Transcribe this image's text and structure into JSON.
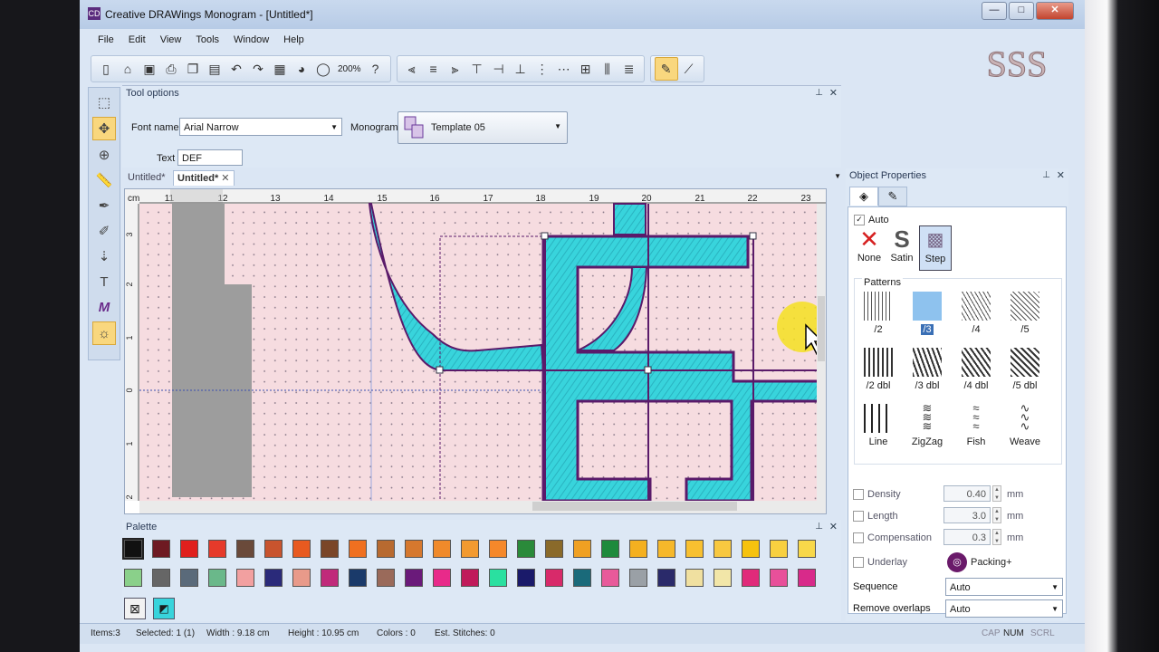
{
  "window": {
    "title": "Creative DRAWings Monogram - [Untitled*]",
    "min": "—",
    "max": "□",
    "close": "✕"
  },
  "menu": [
    "File",
    "Edit",
    "View",
    "Tools",
    "Window",
    "Help"
  ],
  "toolbar": {
    "zoom": "200%"
  },
  "logo": {
    "text": "SSS"
  },
  "tool_options": {
    "header": "Tool options",
    "font_label": "Font name",
    "font_value": "Arial Narrow",
    "monogram_label": "Monogram",
    "monogram_value": "Template 05",
    "text_label": "Text",
    "text_value": "DEF"
  },
  "doc_tabs": [
    "Untitled*",
    "Untitled*"
  ],
  "ruler": {
    "unit": "cm",
    "x_ticks": [
      "11",
      "12",
      "13",
      "14",
      "15",
      "16",
      "17",
      "18",
      "19",
      "20",
      "21",
      "22",
      "23"
    ],
    "y_ticks": [
      "3",
      "2",
      "1",
      "0",
      "1",
      "2"
    ]
  },
  "palette": {
    "header": "Palette"
  },
  "object_properties": {
    "header": "Object Properties",
    "auto_label": "Auto",
    "fill_types": [
      "None",
      "Satin",
      "Step"
    ],
    "patterns_header": "Patterns",
    "patterns": [
      "/2",
      "/3",
      "/4",
      "/5",
      "/2 dbl",
      "/3 dbl",
      "/4 dbl",
      "/5 dbl",
      "Line",
      "ZigZag",
      "Fish",
      "Weave"
    ],
    "selected_pattern": "/3",
    "density_label": "Density",
    "density_value": "0.40",
    "length_label": "Length",
    "length_value": "3.0",
    "compensation_label": "Compensation",
    "compensation_value": "0.3",
    "unit": "mm",
    "underlay_label": "Underlay",
    "underlay_value": "Packing+",
    "sequence_label": "Sequence",
    "sequence_value": "Auto",
    "overlaps_label": "Remove overlaps",
    "overlaps_value": "Auto"
  },
  "status": {
    "items": "Items:3",
    "selected": "Selected: 1 (1)",
    "width": "Width : 9.18 cm",
    "height": "Height : 10.95 cm",
    "colors": "Colors : 0",
    "stitches": "Est. Stitches: 0",
    "cap": "CAP",
    "num": "NUM",
    "scrl": "SCRL"
  },
  "colors": {
    "thread_fill": "#38d4dc",
    "outline": "#5a1a6a",
    "hoop_bg": "#f6dce0"
  }
}
